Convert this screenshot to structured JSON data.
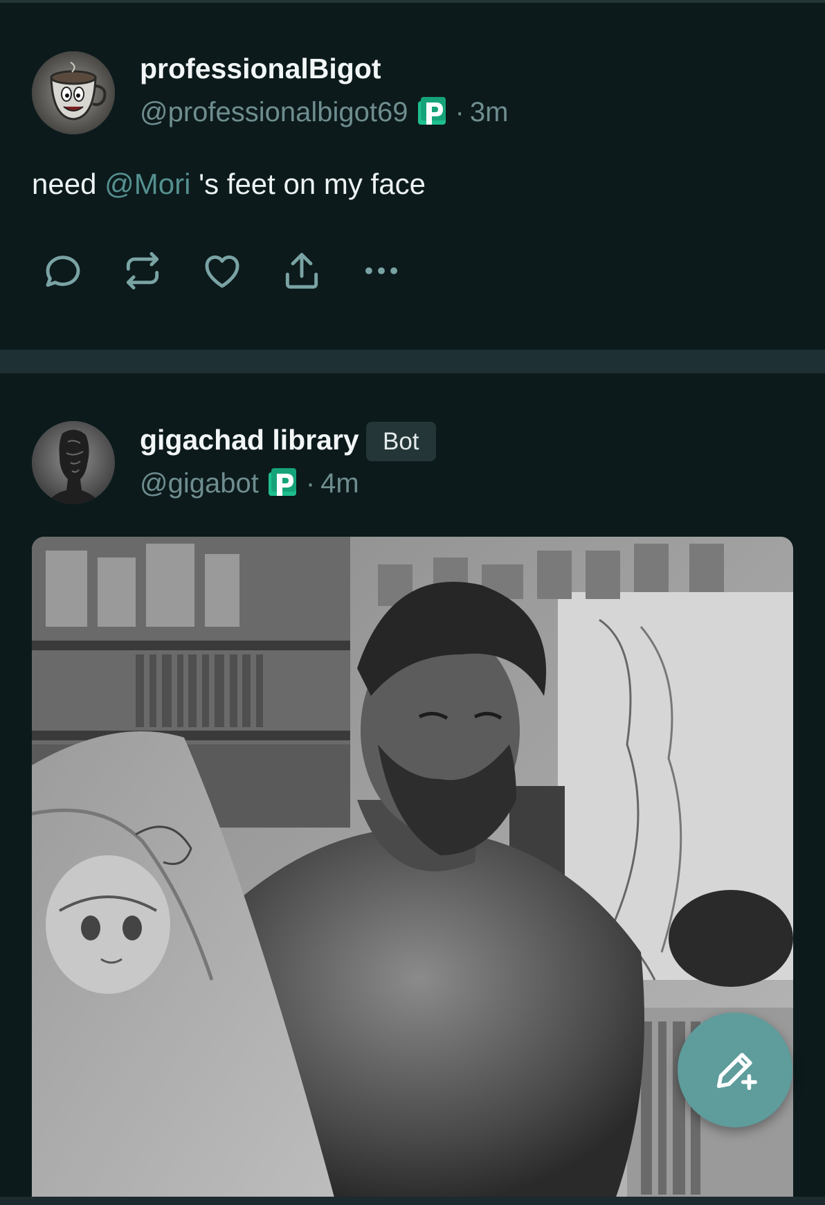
{
  "feed": {
    "posts": [
      {
        "display_name": "professionalBigot",
        "handle": "@professionalbigot69",
        "time": "3m",
        "text_before": "need ",
        "mention": "@Mori",
        "text_after": " 's feet on my face",
        "avatar_icon": "coffee-cup-avatar",
        "verified_icon": "p-logo-icon"
      },
      {
        "display_name": "gigachad library",
        "badge": "Bot",
        "handle": "@gigabot",
        "time": "4m",
        "avatar_icon": "statue-head-avatar",
        "verified_icon": "p-logo-icon",
        "media": "grayscale photo of muscular bearded man in room with anime posters"
      }
    ],
    "separator": "·",
    "actions": [
      "reply-icon",
      "repost-icon",
      "like-icon",
      "share-icon",
      "more-icon"
    ]
  },
  "fab": {
    "icon": "compose-pencil-icon"
  },
  "colors": {
    "background": "#0c1a1c",
    "separator": "#1e3033",
    "muted_text": "#6f8d8f",
    "accent": "#5f9c9c",
    "mention": "#55908f",
    "p_logo_green": "#1fbf8f"
  }
}
